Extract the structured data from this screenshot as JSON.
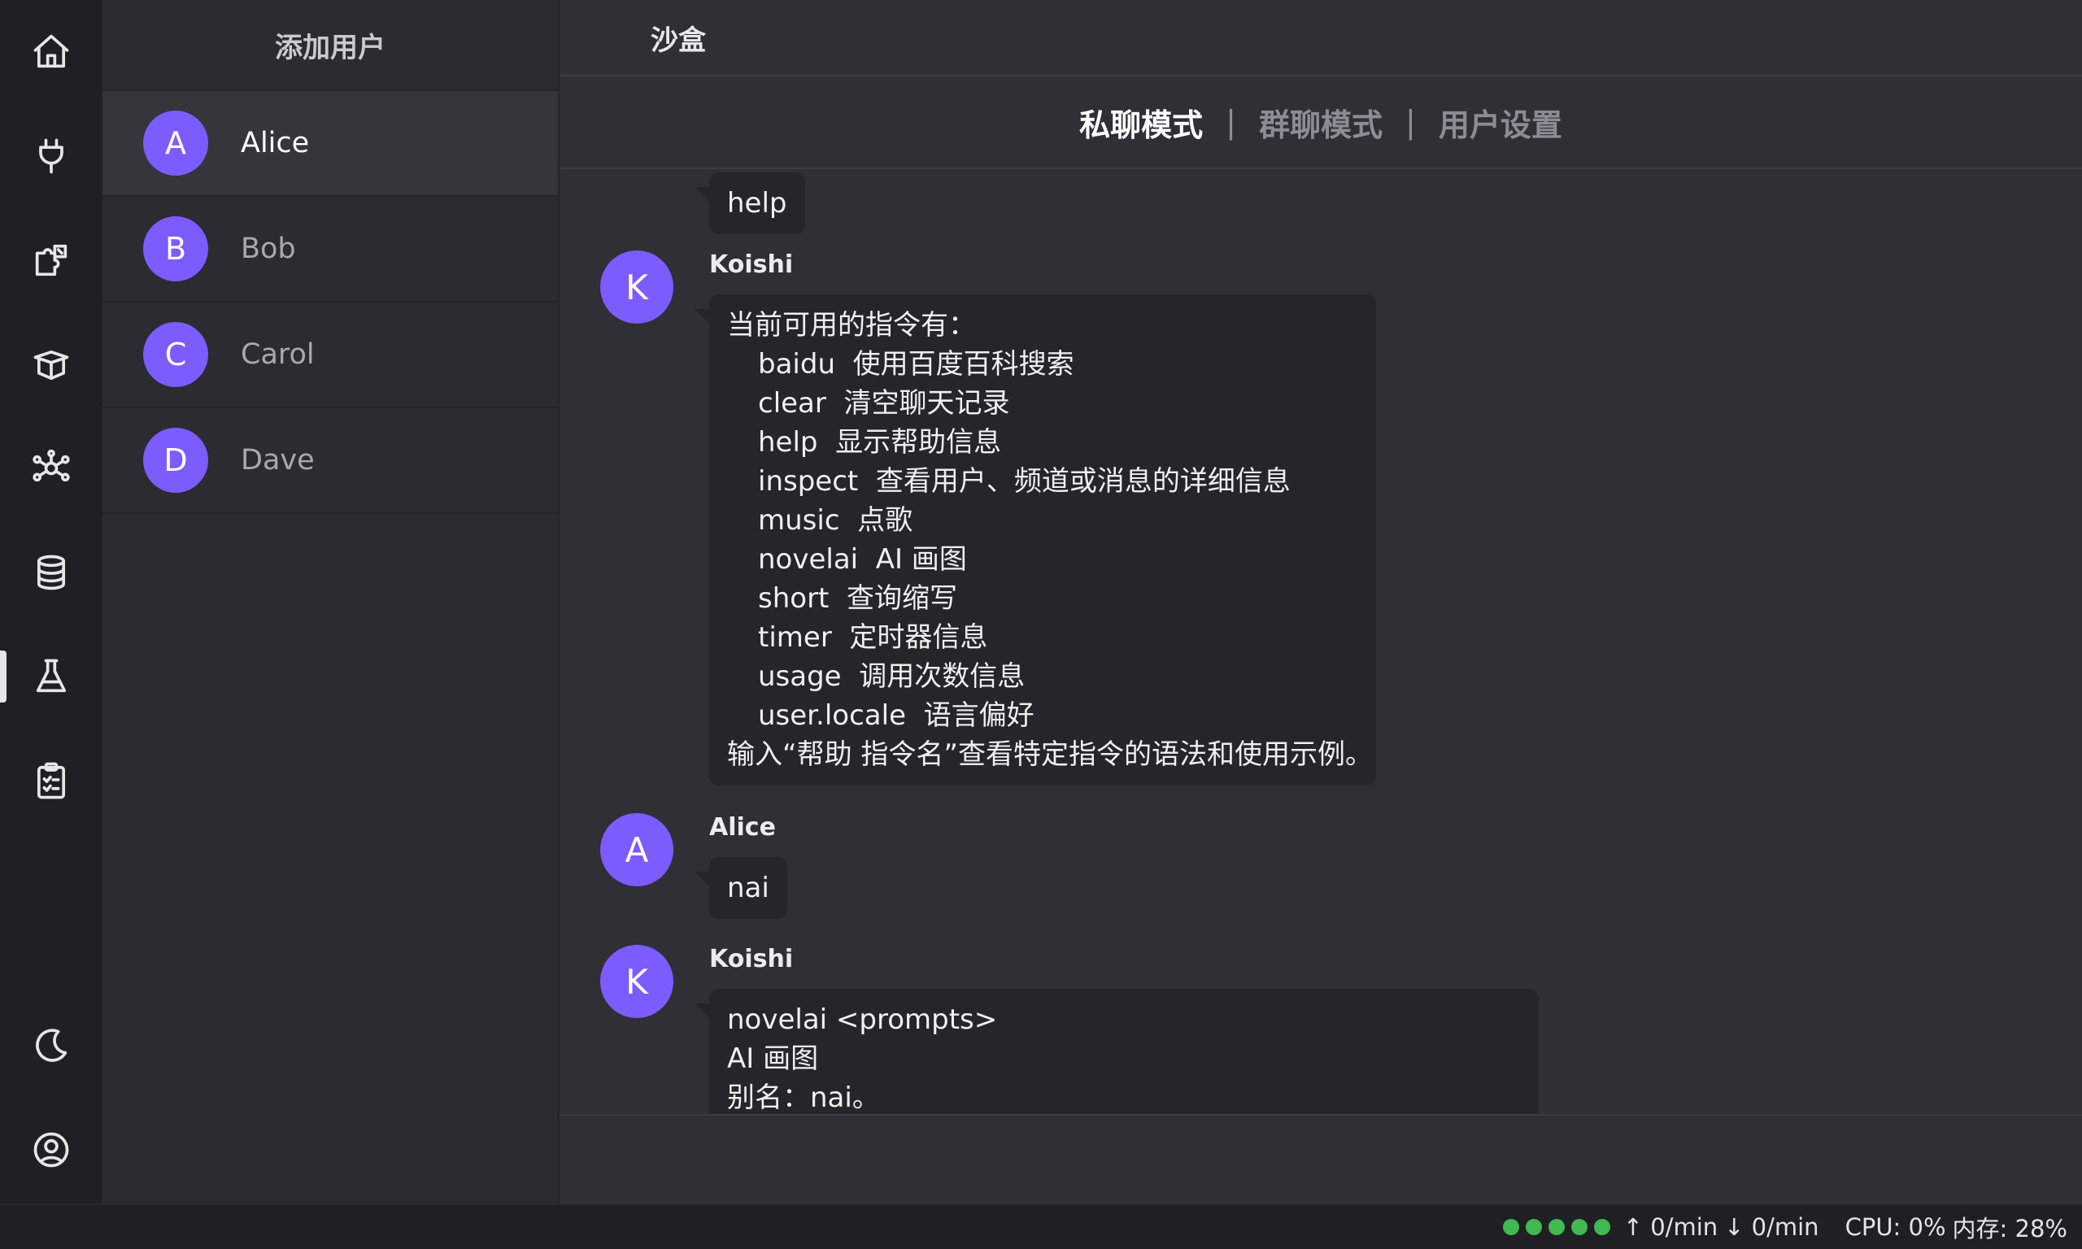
{
  "sidebar": {
    "add_user_label": "添加用户",
    "users": [
      {
        "initial": "A",
        "name": "Alice"
      },
      {
        "initial": "B",
        "name": "Bob"
      },
      {
        "initial": "C",
        "name": "Carol"
      },
      {
        "initial": "D",
        "name": "Dave"
      }
    ]
  },
  "activity_bar": {
    "icons": [
      "home-icon",
      "plug-icon",
      "puzzle-icon",
      "box-icon",
      "network-icon",
      "database-icon",
      "flask-icon",
      "clipboard-icon",
      "moon-icon",
      "user-circle-icon"
    ],
    "active": "flask-icon"
  },
  "main": {
    "title": "沙盒",
    "tabs": [
      {
        "label": "私聊模式",
        "active": true
      },
      {
        "label": "群聊模式",
        "active": false
      },
      {
        "label": "用户设置",
        "active": false
      }
    ],
    "tab_separator": "|"
  },
  "chat": {
    "messages": [
      {
        "text": "help"
      },
      {
        "initial": "K",
        "sender": "Koishi",
        "intro": "当前可用的指令有：",
        "commands": [
          "baidu  使用百度百科搜索",
          "clear  清空聊天记录",
          "help  显示帮助信息",
          "inspect  查看用户、频道或消息的详细信息",
          "music  点歌",
          "novelai  AI 画图",
          "short  查询缩写",
          "timer  定时器信息",
          "usage  调用次数信息",
          "user.locale  语言偏好"
        ],
        "outro": "输入“帮助 指令名”查看特定指令的语法和使用示例。"
      },
      {
        "initial": "A",
        "sender": "Alice",
        "text": "nai"
      },
      {
        "initial": "K",
        "sender": "Koishi",
        "lines": [
          "novelai <prompts>",
          "AI 画图",
          "别名：nai。"
        ]
      }
    ]
  },
  "status": {
    "indicator_color": "#3fb950",
    "indicator_count": 5,
    "upload": "↑ 0/min",
    "download": "↓ 0/min",
    "cpu": "CPU: 0%",
    "memory": "内存: 28%"
  },
  "colors": {
    "accent": "#7c5cff",
    "background": "#2f2f35"
  }
}
